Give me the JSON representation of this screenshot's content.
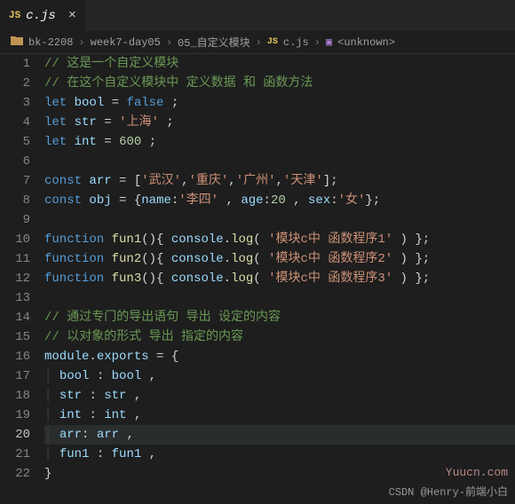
{
  "tab": {
    "icon_label": "JS",
    "filename": "c.js",
    "close": "×"
  },
  "breadcrumb": {
    "folder_icon": "📁",
    "seg1": "bk-2208",
    "seg2": "week7-day05",
    "seg3": "05_自定义模块",
    "js_icon": "JS",
    "file": "c.js",
    "sym_icon": "▣",
    "symbol": "<unknown>",
    "chevron": "›"
  },
  "gutter": {
    "lines": [
      "1",
      "2",
      "3",
      "4",
      "5",
      "6",
      "7",
      "8",
      "9",
      "10",
      "11",
      "12",
      "13",
      "14",
      "15",
      "16",
      "17",
      "18",
      "19",
      "20",
      "21",
      "22"
    ],
    "active_line": 20
  },
  "code": {
    "l1_comment": "// 这是一个自定义模块",
    "l2_comment": "// 在这个自定义模块中 定义数据 和 函数方法",
    "l3": {
      "kw": "let",
      "name": "bool",
      "eq": "=",
      "val": "false",
      "end": ";"
    },
    "l4": {
      "kw": "let",
      "name": "str",
      "eq": "=",
      "val": "'上海'",
      "end": ";"
    },
    "l5": {
      "kw": "let",
      "name": "int",
      "eq": "=",
      "val": "600",
      "end": ";"
    },
    "l7": {
      "kw": "const",
      "name": "arr",
      "eq": "=",
      "open": "[",
      "v1": "'武汉'",
      "v2": "'重庆'",
      "v3": "'广州'",
      "v4": "'天津'",
      "close": "];"
    },
    "l8": {
      "kw": "const",
      "name": "obj",
      "eq": "=",
      "open": "{",
      "k1": "name",
      "c": ":",
      "v1": "'李四'",
      "k2": "age",
      "v2": "20",
      "k3": "sex",
      "v3": "'女'",
      "close": "};"
    },
    "l10": {
      "kw": "function",
      "name": "fun1",
      "parens": "(){",
      "obj": "console",
      "dot": ".",
      "fn": "log",
      "p1": "(",
      "str": "'模块c中 函数程序1'",
      "p2": ") };"
    },
    "l11": {
      "kw": "function",
      "name": "fun2",
      "parens": "(){",
      "obj": "console",
      "dot": ".",
      "fn": "log",
      "p1": "(",
      "str": "'模块c中 函数程序2'",
      "p2": ") };"
    },
    "l12": {
      "kw": "function",
      "name": "fun3",
      "parens": "(){",
      "obj": "console",
      "dot": ".",
      "fn": "log",
      "p1": "(",
      "str": "'模块c中 函数程序3'",
      "p2": ") };"
    },
    "l14_comment": "// 通过专门的导出语句 导出 设定的内容",
    "l15_comment": "// 以对象的形式 导出 指定的内容",
    "l16": {
      "obj": "module",
      "dot": ".",
      "prop": "exports",
      "eq": "=",
      "brace": "{"
    },
    "l17": {
      "key": "bool",
      "colon": ":",
      "val": "bool",
      "comma": ","
    },
    "l18": {
      "key": "str",
      "colon": ":",
      "val": "str",
      "comma": ","
    },
    "l19": {
      "key": "int",
      "colon": ":",
      "val": "int",
      "comma": ","
    },
    "l20": {
      "key": "arr",
      "colon": ":",
      "val": "arr",
      "comma": ","
    },
    "l21": {
      "key": "fun1",
      "colon": ":",
      "val": "fun1",
      "comma": ","
    },
    "l22": {
      "brace": "}"
    }
  },
  "watermark1": "Yuucn.com",
  "watermark2": "CSDN @Henry-前端小白"
}
